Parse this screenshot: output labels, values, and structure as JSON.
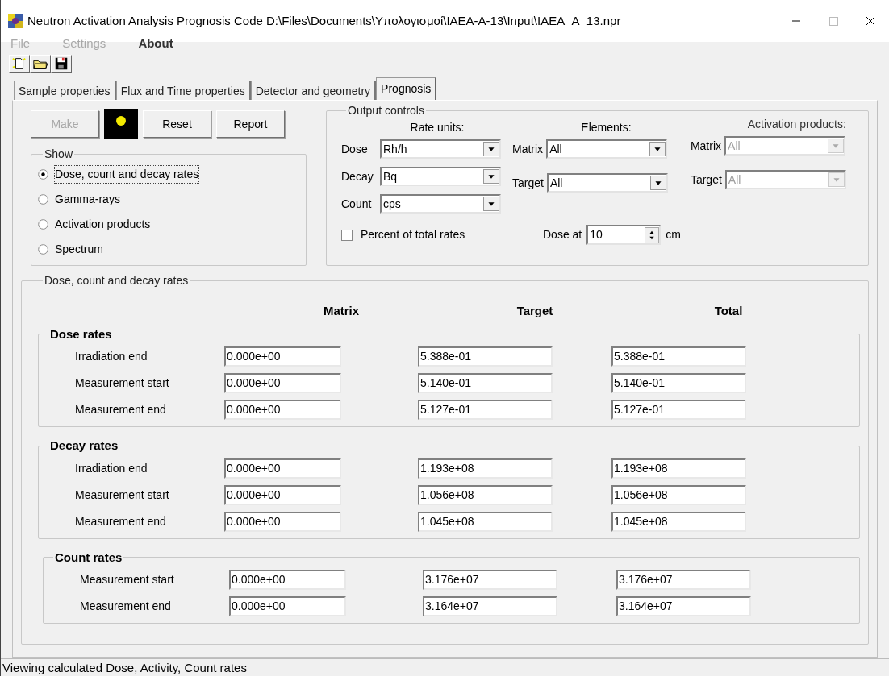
{
  "window": {
    "title": "Neutron Activation Analysis Prognosis Code D:\\Files\\Documents\\Υπολογισμοί\\IAEA-A-13\\Input\\IAEA_A_13.npr"
  },
  "menu": [
    {
      "label": "File",
      "disabled": true
    },
    {
      "label": "Settings",
      "disabled": true
    },
    {
      "label": "About",
      "disabled": false
    }
  ],
  "tabs": [
    {
      "label": "Sample properties",
      "selected": false
    },
    {
      "label": "Flux and Time properties",
      "selected": false
    },
    {
      "label": "Detector and geometry",
      "selected": false
    },
    {
      "label": "Prognosis",
      "selected": true
    }
  ],
  "buttons": [
    {
      "kind": "button",
      "label": "Make",
      "disabled": true
    },
    {
      "kind": "indicator"
    },
    {
      "kind": "button",
      "label": "Reset",
      "disabled": false
    },
    {
      "kind": "button",
      "label": "Report",
      "disabled": false
    }
  ],
  "show": {
    "title": "Show",
    "options": [
      {
        "label": "Dose, count and decay rates",
        "selected": true
      },
      {
        "label": "Gamma-rays",
        "selected": false
      },
      {
        "label": "Activation products",
        "selected": false
      },
      {
        "label": "Spectrum",
        "selected": false
      }
    ]
  },
  "output_controls": {
    "title": "Output controls",
    "groups": [
      {
        "heading": "Rate units:",
        "disabled": false,
        "rows": [
          {
            "label": "Dose",
            "value": "Rh/h"
          },
          {
            "label": "Decay",
            "value": "Bq"
          },
          {
            "label": "Count",
            "value": "cps"
          }
        ]
      },
      {
        "heading": "Elements:",
        "disabled": false,
        "rows": [
          {
            "label": "Matrix",
            "value": "All"
          },
          {
            "label": "Target",
            "value": "All"
          }
        ]
      },
      {
        "heading": "Activation products:",
        "disabled": true,
        "rows": [
          {
            "label": "Matrix",
            "value": "All"
          },
          {
            "label": "Target",
            "value": "All"
          }
        ]
      }
    ],
    "percent": {
      "label": "Percent of total rates",
      "checked": false
    },
    "dose_at": {
      "label": "Dose at",
      "value": "10",
      "unit": "cm"
    }
  },
  "results": {
    "title": "Dose, count and decay rates",
    "columns": [
      "Matrix",
      "Target",
      "Total"
    ],
    "sections": [
      {
        "title": "Dose rates",
        "rows": [
          {
            "label": "Irradiation end",
            "values": [
              "0.000e+00",
              "5.388e-01",
              "5.388e-01"
            ]
          },
          {
            "label": "Measurement start",
            "values": [
              "0.000e+00",
              "5.140e-01",
              "5.140e-01"
            ]
          },
          {
            "label": "Measurement end",
            "values": [
              "0.000e+00",
              "5.127e-01",
              "5.127e-01"
            ]
          }
        ]
      },
      {
        "title": "Decay rates",
        "rows": [
          {
            "label": "Irradiation end",
            "values": [
              "0.000e+00",
              "1.193e+08",
              "1.193e+08"
            ]
          },
          {
            "label": "Measurement start",
            "values": [
              "0.000e+00",
              "1.056e+08",
              "1.056e+08"
            ]
          },
          {
            "label": "Measurement end",
            "values": [
              "0.000e+00",
              "1.045e+08",
              "1.045e+08"
            ]
          }
        ]
      },
      {
        "title": "Count rates",
        "rows": [
          {
            "label": "Measurement start",
            "values": [
              "0.000e+00",
              "3.176e+07",
              "3.176e+07"
            ]
          },
          {
            "label": "Measurement end",
            "values": [
              "0.000e+00",
              "3.164e+07",
              "3.164e+07"
            ]
          }
        ]
      }
    ]
  },
  "status_bar": "Viewing calculated Dose, Activity, Count rates"
}
